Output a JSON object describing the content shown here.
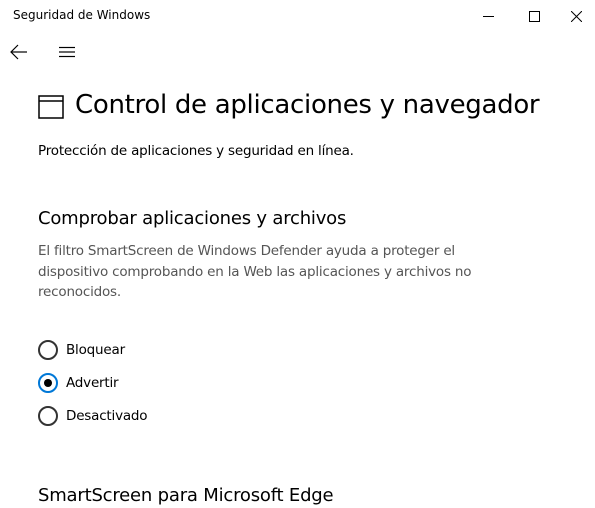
{
  "window": {
    "title": "Seguridad de Windows"
  },
  "page": {
    "title": "Control de aplicaciones y navegador",
    "subtitle": "Protección de aplicaciones y seguridad en línea."
  },
  "check_apps": {
    "title": "Comprobar aplicaciones y archivos",
    "description": "El filtro SmartScreen de Windows Defender ayuda a proteger el dispositivo comprobando en la Web las aplicaciones y archivos no reconocidos.",
    "options": [
      {
        "label": "Bloquear",
        "selected": false
      },
      {
        "label": "Advertir",
        "selected": true
      },
      {
        "label": "Desactivado",
        "selected": false
      }
    ]
  },
  "edge_section": {
    "title": "SmartScreen para Microsoft Edge"
  },
  "colors": {
    "accent": "#0078d7",
    "description_text": "#555555"
  },
  "icons": {
    "back": "arrow-left-icon",
    "menu": "hamburger-menu-icon",
    "page": "browser-window-icon",
    "minimize": "minimize-icon",
    "maximize": "maximize-icon",
    "close": "close-icon"
  }
}
